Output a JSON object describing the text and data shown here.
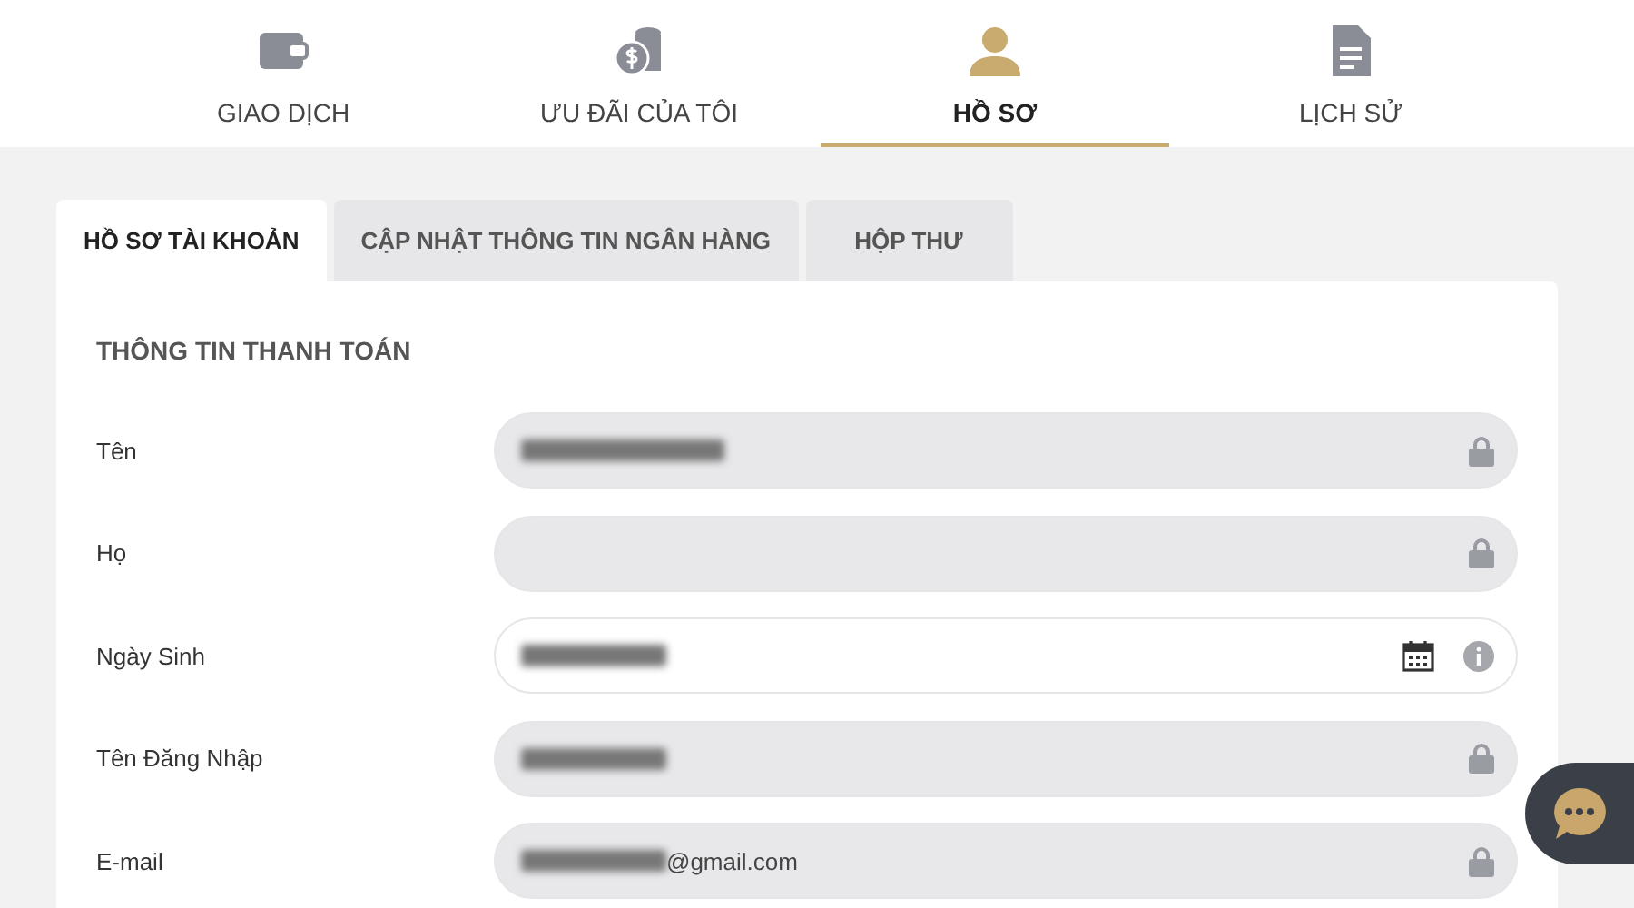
{
  "main_nav": [
    {
      "label": "GIAO DỊCH",
      "kind": "wallet",
      "selected": false
    },
    {
      "label": "ƯU ĐÃI CỦA TÔI",
      "kind": "coins",
      "selected": false
    },
    {
      "label": "HỒ SƠ",
      "kind": "person",
      "selected": true
    },
    {
      "label": "LỊCH SỬ",
      "kind": "document",
      "selected": false
    }
  ],
  "sub_tabs": [
    {
      "label": "HỒ SƠ TÀI KHOẢN",
      "selected": true
    },
    {
      "label": "CẬP NHẬT THÔNG TIN NGÂN HÀNG",
      "selected": false
    },
    {
      "label": "HỘP THƯ",
      "selected": false
    }
  ],
  "section_title": "THÔNG TIN THANH TOÁN",
  "fields": [
    {
      "label": "Tên",
      "kind": "locked",
      "value_hidden": true
    },
    {
      "label": "Họ",
      "kind": "locked",
      "value_hidden": false
    },
    {
      "label": "Ngày Sinh",
      "kind": "date",
      "value_hidden": true
    },
    {
      "label": "Tên Đăng Nhập",
      "kind": "locked",
      "value_hidden": true
    },
    {
      "label": "E-mail",
      "kind": "locked",
      "value_hidden": true,
      "value": "@gmail.com"
    }
  ],
  "chat_widget": {
    "kind": "chat"
  }
}
